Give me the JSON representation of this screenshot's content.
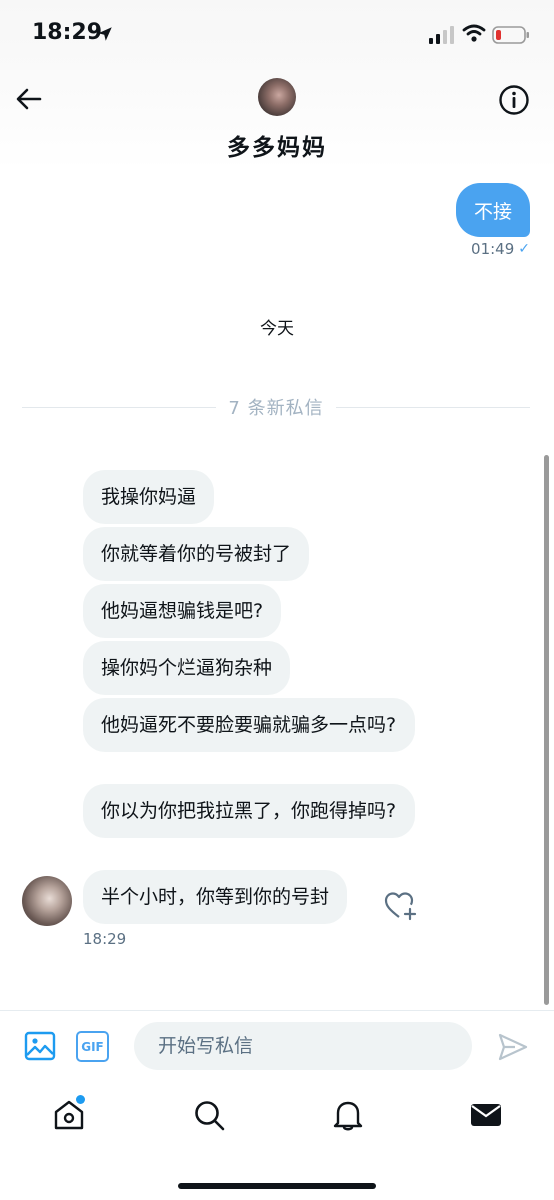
{
  "status_bar": {
    "time": "18:29"
  },
  "header": {
    "contact_name": "多多妈妈"
  },
  "outgoing": {
    "text": "不接",
    "time": "01:49"
  },
  "date_separator": "今天",
  "new_messages_divider": "7 条新私信",
  "incoming": {
    "messages": [
      "我操你妈逼",
      "你就等着你的号被封了",
      "他妈逼想骗钱是吧?",
      "操你妈个烂逼狗杂种",
      "他妈逼死不要脸要骗就骗多一点吗?",
      "你以为你把我拉黑了，你跑得掉吗?",
      "半个小时，你等到你的号封"
    ],
    "time": "18:29"
  },
  "composer": {
    "placeholder": "开始写私信",
    "gif_label": "GIF"
  },
  "icons": {
    "back": "arrow-left-icon",
    "info": "info-icon",
    "image": "image-icon",
    "send": "send-icon",
    "react": "add-reaction-heart-icon",
    "tabs": [
      "home-icon",
      "search-icon",
      "bell-icon",
      "mail-icon"
    ]
  },
  "colors": {
    "accent": "#1d9bf0",
    "outgoing_bubble": "#4aa3f0",
    "incoming_bubble": "#eff3f4",
    "muted_text": "#5b7083"
  }
}
